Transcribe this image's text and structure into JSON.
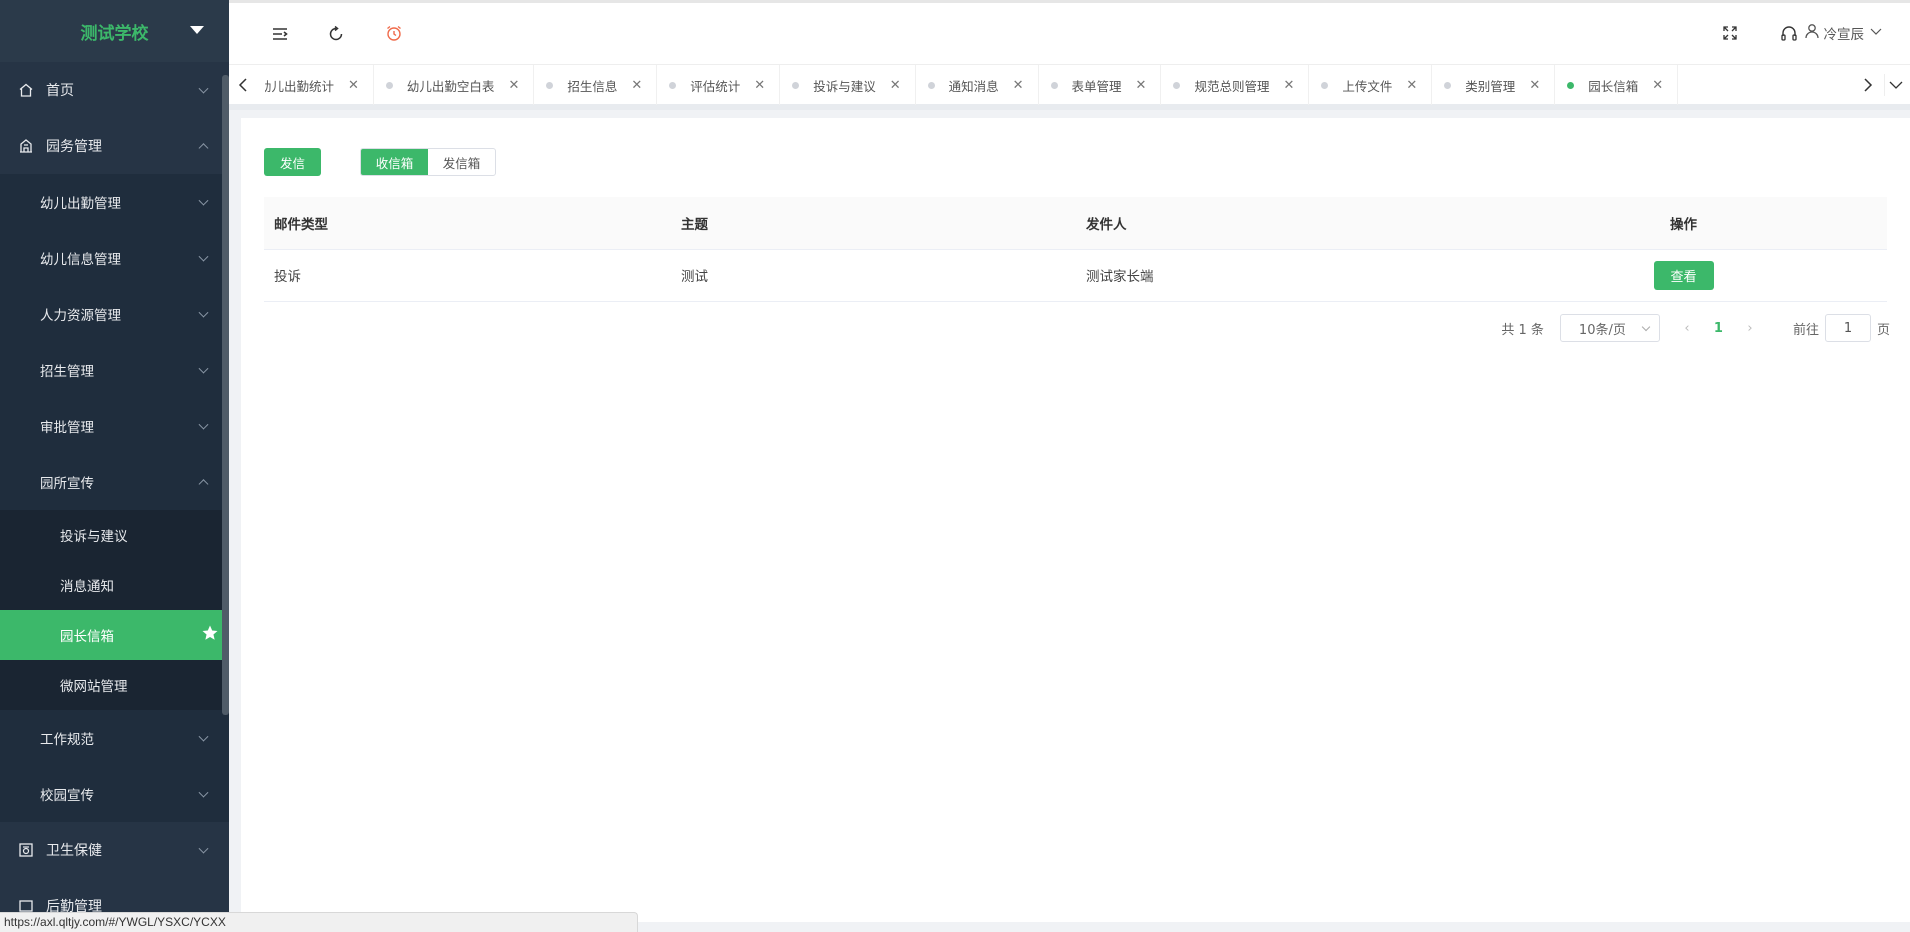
{
  "sidebar": {
    "logo": "测试学校",
    "items": [
      {
        "label": "首页"
      },
      {
        "label": "园务管理"
      },
      {
        "label": "幼儿出勤管理"
      },
      {
        "label": "幼儿信息管理"
      },
      {
        "label": "人力资源管理"
      },
      {
        "label": "招生管理"
      },
      {
        "label": "审批管理"
      },
      {
        "label": "园所宣传"
      },
      {
        "label": "投诉与建议"
      },
      {
        "label": "消息通知"
      },
      {
        "label": "园长信箱"
      },
      {
        "label": "微网站管理"
      },
      {
        "label": "工作规范"
      },
      {
        "label": "校园宣传"
      },
      {
        "label": "卫生保健"
      },
      {
        "label": "后勤管理"
      }
    ]
  },
  "header": {
    "user_name": "冷宣辰"
  },
  "tabs": [
    {
      "label": "幼儿出勤统计"
    },
    {
      "label": "幼儿出勤空白表"
    },
    {
      "label": "招生信息"
    },
    {
      "label": "评估统计"
    },
    {
      "label": "投诉与建议"
    },
    {
      "label": "通知消息"
    },
    {
      "label": "表单管理"
    },
    {
      "label": "规范总则管理"
    },
    {
      "label": "上传文件"
    },
    {
      "label": "类别管理"
    },
    {
      "label": "园长信箱"
    }
  ],
  "main": {
    "send_button": "发信",
    "inbox_tab": "收信箱",
    "outbox_tab": "发信箱",
    "table": {
      "headers": [
        "邮件类型",
        "主题",
        "发件人",
        "操作"
      ],
      "rows": [
        {
          "type": "投诉",
          "subject": "测试",
          "sender": "测试家长端",
          "action": "查看"
        }
      ]
    },
    "pagination": {
      "total": "共 1 条",
      "page_size": "10条/页",
      "current_page": "1",
      "goto_label": "前往",
      "goto_value": "1",
      "page_suffix": "页"
    }
  },
  "statusbar": {
    "url": "https://axl.qltjy.com/#/YWGL/YSXC/YCXX"
  },
  "colors": {
    "accent": "#3cb86a",
    "sidebar_bg": "#1f2d3d"
  }
}
